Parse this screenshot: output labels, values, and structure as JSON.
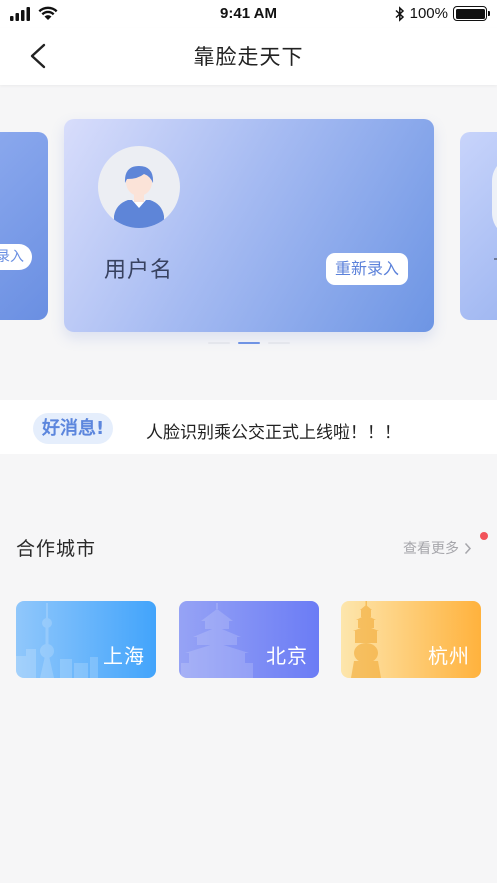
{
  "status_bar": {
    "time": "9:41 AM",
    "battery": "100%"
  },
  "nav": {
    "title": "靠脸走天下"
  },
  "carousel": {
    "main_card": {
      "username": "用户名",
      "reenter_label": "重新录入"
    },
    "left_card": {
      "button_label": "录入"
    },
    "active_index": 2,
    "dot_count": 3
  },
  "news": {
    "badge": "好消息!",
    "text": "人脸识别乘公交正式上线啦！！！"
  },
  "cities_section": {
    "title": "合作城市",
    "more_label": "查看更多",
    "cities": [
      {
        "name": "上海"
      },
      {
        "name": "北京"
      },
      {
        "name": "杭州"
      }
    ]
  },
  "colors": {
    "accent": "#6f93e4",
    "badge_bg": "#e5eefc",
    "notification_dot": "#f2535a"
  }
}
